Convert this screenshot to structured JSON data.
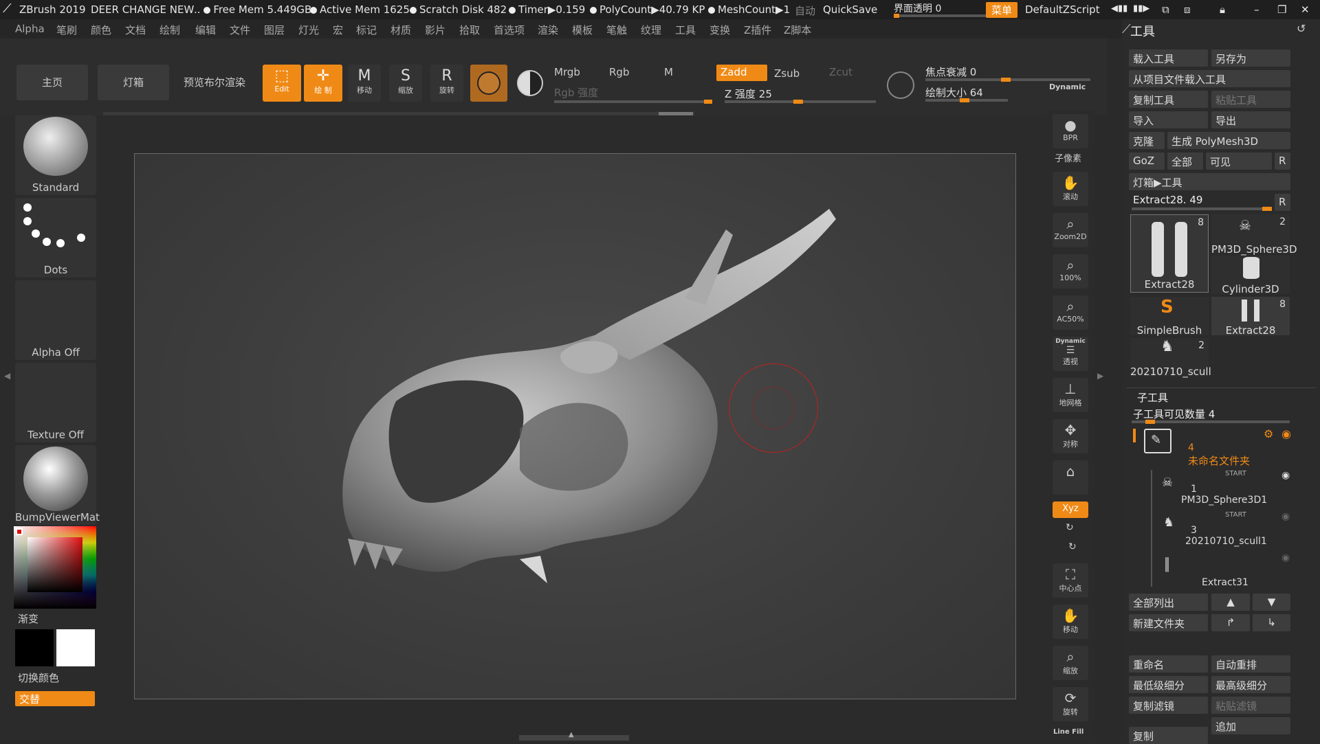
{
  "titlebar": {
    "app": "ZBrush 2019",
    "doc": "DEER CHANGE NEW",
    "free_mem": "Free Mem 5.449GB",
    "active_mem": "Active Mem 1625",
    "scratch": "Scratch Disk 482",
    "timer": "Timer▶0.159",
    "poly": "PolyCount▶40.79 KP",
    "mesh": "MeshCount▶1",
    "auto": "自动",
    "quicksave": "QuickSave",
    "transparency": "界面透明 0",
    "menu_btn": "菜单",
    "script": "DefaultZScript"
  },
  "menubar": [
    "Alpha",
    "笔刷",
    "颜色",
    "文档",
    "绘制",
    "编辑",
    "文件",
    "图层",
    "灯光",
    "宏",
    "标记",
    "材质",
    "影片",
    "拾取",
    "首选项",
    "渲染",
    "模板",
    "笔触",
    "纹理",
    "工具",
    "变换",
    "Z插件",
    "Z脚本"
  ],
  "toolbar": {
    "home": "主页",
    "lightbox": "灯箱",
    "bpr_preview": "预览布尔渲染",
    "edit": "Edit",
    "draw": "绘 制",
    "move": "移动",
    "scale": "缩放",
    "rotate": "旋转",
    "mrgb": "Mrgb",
    "rgb": "Rgb",
    "m": "M",
    "rgb_intensity": "Rgb 强度",
    "zadd": "Zadd",
    "zsub": "Zsub",
    "zcut": "Zcut",
    "z_intensity": "Z 强度 25",
    "focal": "焦点衰减 0",
    "draw_size": "绘制大小 64",
    "dynamic": "Dynamic",
    "icon_m": "M",
    "icon_s": "S",
    "icon_r": "R"
  },
  "toolbar_values": {
    "z_intensity": 25,
    "focal": 0,
    "draw_size": 64
  },
  "leftpanel": {
    "brush": "Standard",
    "stroke": "Dots",
    "alpha": "Alpha Off",
    "texture": "Texture Off",
    "material": "BumpViewerMat",
    "gradient": "渐变",
    "switch_color": "切换颜色",
    "alternate": "交替"
  },
  "colors": {
    "accent": "#f08a16",
    "main_color": "#000000",
    "secondary_color": "#ffffff"
  },
  "righttools": {
    "bpr": "BPR",
    "subpixel": "子像素",
    "scroll": "滚动",
    "zoom2d": "Zoom2D",
    "z100": "100%",
    "ac50": "AC50%",
    "dynamic": "Dynamic",
    "persp": "透视",
    "floor": "地网格",
    "sym": "对称",
    "lock": "",
    "xyz": "Xyz",
    "center": "中心点",
    "move": "移动",
    "scale": "缩放",
    "rotate": "旋转",
    "linefill": "Line Fill"
  },
  "rightpanel": {
    "title": "工具",
    "load": "载入工具",
    "saveas": "另存为",
    "fromproject": "从项目文件载入工具",
    "copy": "复制工具",
    "paste": "粘贴工具",
    "import": "导入",
    "export": "导出",
    "clone": "克隆",
    "make_poly": "生成 PolyMesh3D",
    "goz": "GoZ",
    "all": "全部",
    "visible": "可见",
    "r": "R",
    "lightbox_tools": "灯箱▶工具",
    "current": "Extract28. 49",
    "current_value": 49,
    "thumbs": [
      {
        "name": "Extract28",
        "count": "8"
      },
      {
        "name": "PM3D_Sphere3D",
        "count": "2"
      },
      {
        "name": "Cylinder3D",
        "count": ""
      },
      {
        "name": "SimpleBrush",
        "count": ""
      },
      {
        "name": "Extract28",
        "count": "8"
      },
      {
        "name": "20210710_scull",
        "count": "2"
      }
    ],
    "subtool_title": "子工具",
    "subtool_count": "子工具可见数量 4",
    "folder_num": "4",
    "folder_name": "未命名文件夹",
    "start": "START",
    "subtools": [
      {
        "num": "1",
        "name": "PM3D_Sphere3D1"
      },
      {
        "num": "3",
        "name": "20210710_scull1"
      },
      {
        "num": "",
        "name": "Extract31"
      }
    ],
    "list_all": "全部列出",
    "new_folder": "新建文件夹",
    "rename": "重命名",
    "auto_reorder": "自动重排",
    "lowest": "最低级细分",
    "highest": "最高级细分",
    "copy_filter": "复制滤镜",
    "paste_filter": "粘贴滤镜",
    "append": "追加",
    "duplicate": "复制"
  }
}
